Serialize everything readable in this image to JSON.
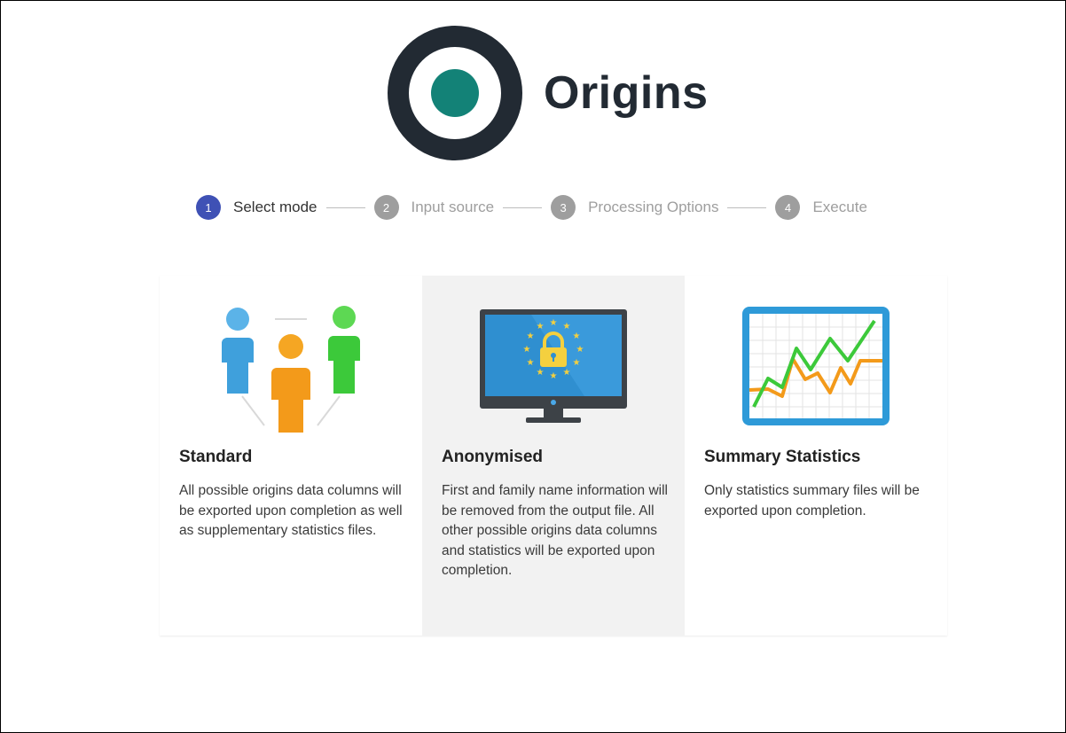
{
  "app": {
    "logo_text": "Origins"
  },
  "stepper": {
    "steps": [
      {
        "number": "1",
        "label": "Select mode"
      },
      {
        "number": "2",
        "label": "Input source"
      },
      {
        "number": "3",
        "label": "Processing Options"
      },
      {
        "number": "4",
        "label": "Execute"
      }
    ],
    "active_step": 1
  },
  "modes": [
    {
      "icon": "users-group-icon",
      "title": "Standard",
      "description": "All possible origins data columns will be exported upon completion as well as supplementary statistics files."
    },
    {
      "icon": "monitor-lock-eu-icon",
      "title": "Anonymised",
      "description": "First and family name information will be removed from the output file. All other possible origins data columns and statistics will be exported upon completion."
    },
    {
      "icon": "line-chart-icon",
      "title": "Summary Statistics",
      "description": "Only statistics summary files will be exported upon completion."
    }
  ],
  "selected_mode": "Anonymised",
  "colors": {
    "logo_ring": "#222a33",
    "logo_dot": "#138277",
    "step_active": "#3f51b5",
    "step_inactive": "#9e9e9e",
    "selected_card_bg": "#f2f2f2"
  }
}
